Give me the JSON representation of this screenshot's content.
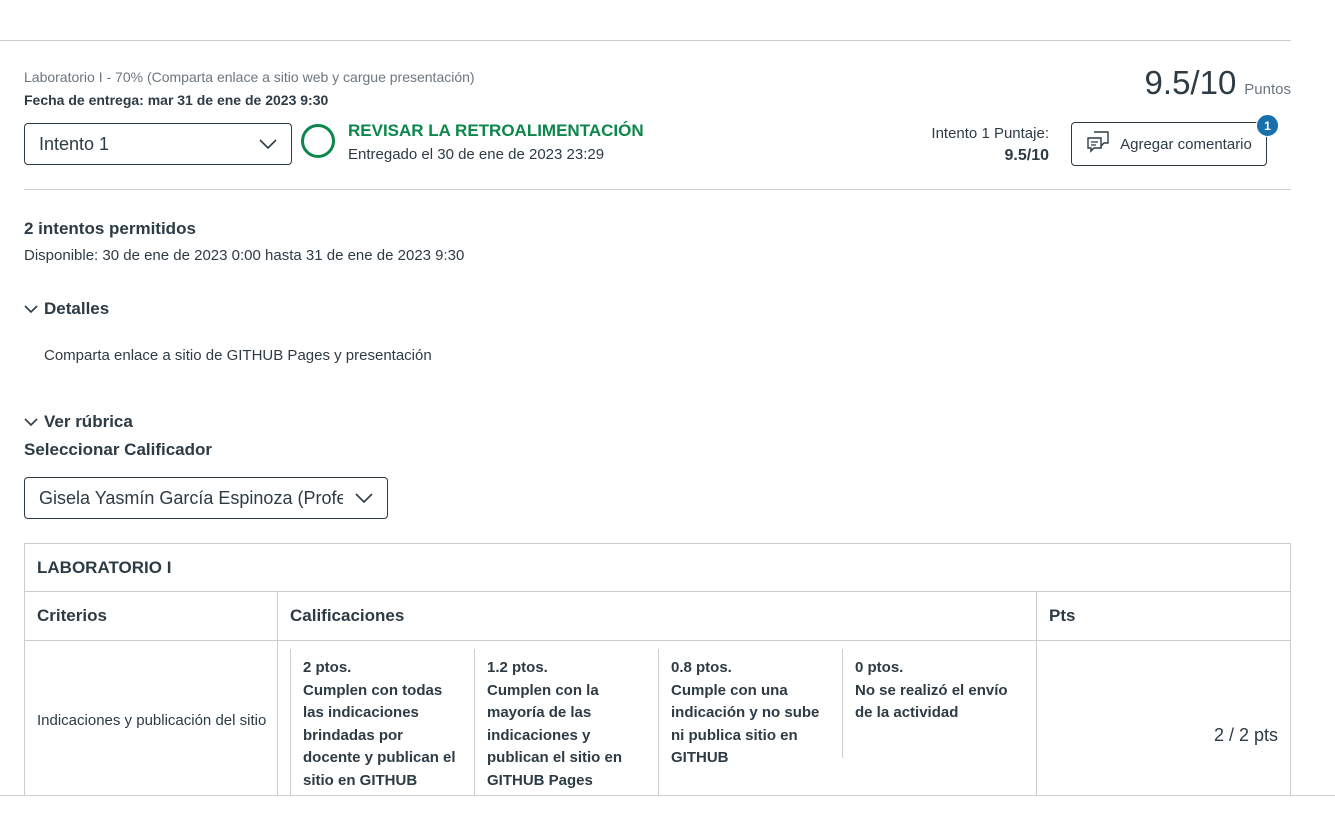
{
  "assignment": {
    "title_line": "Laboratorio I - 70% (Comparta enlace a sitio web y cargue presentación)",
    "due": "Fecha de entrega: mar 31 de ene de 2023 9:30",
    "score": "9.5/10",
    "score_label": "Puntos"
  },
  "attempt": {
    "selected": "Intento 1",
    "status_title": "REVISAR LA RETROALIMENTACIÓN",
    "status_sub": "Entregado el 30 de ene de 2023 23:29",
    "score_label": "Intento 1 Puntaje:",
    "score_value": "9.5/10",
    "comment_button": "Agregar comentario",
    "comment_count": "1"
  },
  "info": {
    "attempts_allowed": "2 intentos permitidos",
    "available": "Disponible: 30 de ene de 2023 0:00 hasta 31 de ene de 2023 9:30",
    "details_toggle": "Detalles",
    "details_text": "Comparta enlace a sitio de GITHUB Pages y presentación",
    "rubric_toggle": "Ver rúbrica",
    "grader_label": "Seleccionar Calificador",
    "grader_selected": "Gisela Yasmín García Espinoza (Profesor)"
  },
  "rubric": {
    "title": "LABORATORIO I",
    "headers": {
      "criteria": "Criterios",
      "ratings": "Calificaciones",
      "points": "Pts"
    },
    "rows": [
      {
        "criterion": "Indicaciones y publicación del sitio",
        "ratings": [
          {
            "pts": "2 ptos.",
            "desc": "Cumplen con todas las indicaciones brindadas por docente y publican el sitio en GITHUB Pages"
          },
          {
            "pts": "1.2 ptos.",
            "desc": "Cumplen con la mayoría de las indicaciones y publican el sitio en GITHUB Pages"
          },
          {
            "pts": "0.8 ptos.",
            "desc": "Cumple con una indicación y no sube ni publica sitio en GITHUB"
          },
          {
            "pts": "0 ptos.",
            "desc": "No se realizó el envío de la actividad"
          }
        ],
        "points": "2 / 2 pts"
      }
    ]
  },
  "colors": {
    "success": "#0b874b",
    "badge": "#1770ab",
    "text": "#2d3b45",
    "muted": "#6b7780"
  }
}
